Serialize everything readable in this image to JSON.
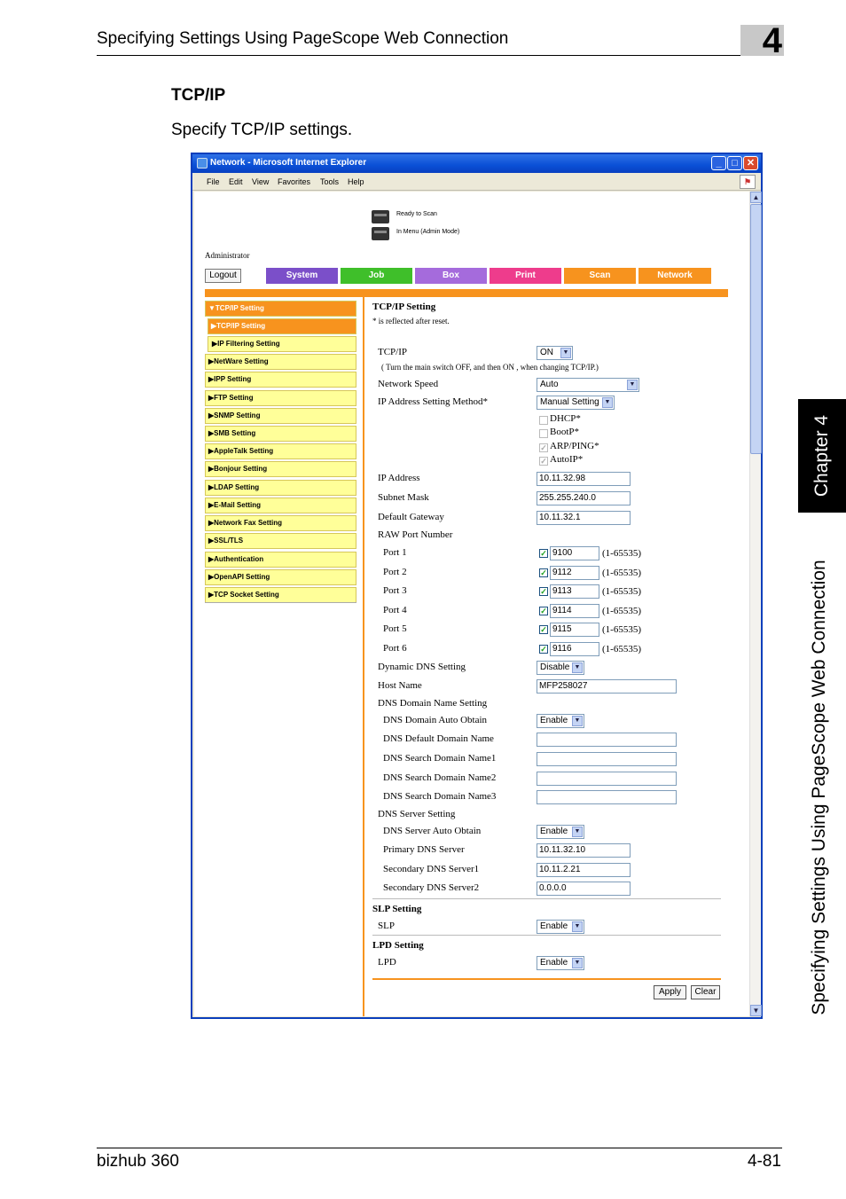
{
  "page_header": {
    "title": "Specifying Settings Using PageScope Web Connection",
    "chapter_number": "4"
  },
  "section": {
    "title": "TCP/IP",
    "description": "Specify TCP/IP settings."
  },
  "side_tab": {
    "chapter_label": "Chapter 4",
    "running_title": "Specifying Settings Using PageScope Web Connection"
  },
  "footer": {
    "product": "bizhub 360",
    "page": "4-81"
  },
  "browser": {
    "title": "Network - Microsoft Internet Explorer",
    "menu": [
      "File",
      "Edit",
      "View",
      "Favorites",
      "Tools",
      "Help"
    ]
  },
  "web": {
    "status_ready": "Ready to Scan",
    "status_mode": "In Menu (Admin Mode)",
    "user": "Administrator",
    "logout": "Logout",
    "tabs": [
      {
        "label": "System",
        "color": "#7b4fc9"
      },
      {
        "label": "Job",
        "color": "#3fbf2a"
      },
      {
        "label": "Box",
        "color": "#a56bdc"
      },
      {
        "label": "Print",
        "color": "#ee3c8c"
      },
      {
        "label": "Scan",
        "color": "#f7931e"
      },
      {
        "label": "Network",
        "color": "#f7931e"
      }
    ],
    "side_menu": [
      "▼TCP/IP Setting",
      "▶TCP/IP Setting",
      "▶IP Filtering Setting",
      "▶NetWare Setting",
      "▶IPP Setting",
      "▶FTP Setting",
      "▶SNMP Setting",
      "▶SMB Setting",
      "▶AppleTalk Setting",
      "▶Bonjour Setting",
      "▶LDAP Setting",
      "▶E-Mail Setting",
      "▶Network Fax Setting",
      "▶SSL/TLS",
      "▶Authentication",
      "▶OpenAPI Setting",
      "▶TCP Socket Setting"
    ],
    "form": {
      "heading": "TCP/IP Setting",
      "note": "* is reflected after reset.",
      "tcpip_label": "TCP/IP",
      "tcpip_value": "ON",
      "tcpip_note": "( Turn the main switch OFF, and then ON , when changing TCP/IP.)",
      "speed_label": "Network Speed",
      "speed_value": "Auto",
      "ipmethod_label": "IP Address Setting Method*",
      "ipmethod_value": "Manual Setting",
      "dhcp": "DHCP*",
      "bootp": "BootP*",
      "arp": "ARP/PING*",
      "autoip": "AutoIP*",
      "ip_label": "IP Address",
      "ip_value": "10.11.32.98",
      "mask_label": "Subnet Mask",
      "mask_value": "255.255.240.0",
      "gw_label": "Default Gateway",
      "gw_value": "10.11.32.1",
      "raw_label": "RAW Port Number",
      "ports": [
        {
          "label": "Port 1",
          "value": "9100",
          "range": "(1-65535)"
        },
        {
          "label": "Port 2",
          "value": "9112",
          "range": "(1-65535)"
        },
        {
          "label": "Port 3",
          "value": "9113",
          "range": "(1-65535)"
        },
        {
          "label": "Port 4",
          "value": "9114",
          "range": "(1-65535)"
        },
        {
          "label": "Port 5",
          "value": "9115",
          "range": "(1-65535)"
        },
        {
          "label": "Port 6",
          "value": "9116",
          "range": "(1-65535)"
        }
      ],
      "ddns_label": "Dynamic DNS Setting",
      "ddns_value": "Disable",
      "host_label": "Host Name",
      "host_value": "MFP258027",
      "dnsdomain_label": "DNS Domain Name Setting",
      "dnsauto_label": "DNS Domain Auto Obtain",
      "dnsauto_value": "Enable",
      "dnsdefault_label": "DNS Default Domain Name",
      "dnssearch1_label": "DNS Search Domain Name1",
      "dnssearch2_label": "DNS Search Domain Name2",
      "dnssearch3_label": "DNS Search Domain Name3",
      "dnsserver_label": "DNS Server Setting",
      "dnsserverauto_label": "DNS Server Auto Obtain",
      "dnsserverauto_value": "Enable",
      "primary_label": "Primary DNS Server",
      "primary_value": "10.11.32.10",
      "secondary1_label": "Secondary DNS Server1",
      "secondary1_value": "10.11.2.21",
      "secondary2_label": "Secondary DNS Server2",
      "secondary2_value": "0.0.0.0",
      "slp_heading": "SLP Setting",
      "slp_label": "SLP",
      "slp_value": "Enable",
      "lpd_heading": "LPD Setting",
      "lpd_label": "LPD",
      "lpd_value": "Enable",
      "apply": "Apply",
      "clear": "Clear"
    }
  }
}
